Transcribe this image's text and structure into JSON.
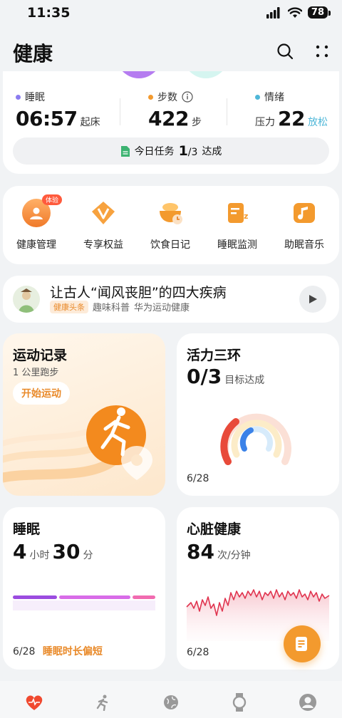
{
  "status_bar": {
    "time": "11:35",
    "battery": "78"
  },
  "header": {
    "title": "健康"
  },
  "summary": {
    "sleep": {
      "label": "睡眠",
      "value": "06:57",
      "unit": "起床",
      "color": "#8b7cf0"
    },
    "steps": {
      "label": "步数",
      "value": "422",
      "unit": "步",
      "color": "#f39a2e"
    },
    "mood": {
      "label": "情绪",
      "prefix": "压力",
      "value": "22",
      "status": "放松",
      "color": "#4fb7d8"
    },
    "task": {
      "label": "今日任务",
      "done": "1",
      "total": "/3",
      "suffix": "达成"
    }
  },
  "shortcuts": [
    {
      "label": "健康管理",
      "badge": "体验",
      "icon": "health-manage-icon"
    },
    {
      "label": "专享权益",
      "icon": "vip-rights-icon"
    },
    {
      "label": "饮食日记",
      "icon": "diet-diary-icon"
    },
    {
      "label": "睡眠监测",
      "icon": "sleep-monitor-icon"
    },
    {
      "label": "助眠音乐",
      "icon": "sleep-music-icon"
    }
  ],
  "news": {
    "title": "让古人“闻风丧胆”的四大疾病",
    "tag": "健康头条",
    "category": "趣味科普",
    "source": "华为运动健康"
  },
  "sport": {
    "title": "运动记录",
    "subtitle": "1 公里跑步",
    "button": "开始运动"
  },
  "rings": {
    "title": "活力三环",
    "value": "0/3",
    "unit": "目标达成",
    "date": "6/28"
  },
  "sleep_tile": {
    "title": "睡眠",
    "hours": "4",
    "hours_unit": "小时",
    "minutes": "30",
    "minutes_unit": "分",
    "date": "6/28",
    "note": "睡眠时长偏短"
  },
  "heart": {
    "title": "心脏健康",
    "value": "84",
    "unit": "次/分钟",
    "date": "6/28"
  },
  "colors": {
    "accent": "#f39a2e",
    "heart_red": "#e0344f",
    "sleep_purple": "#9b4ce0"
  }
}
